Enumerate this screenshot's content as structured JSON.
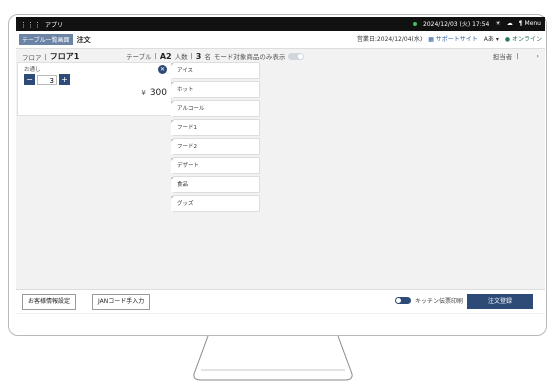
{
  "titlebar": {
    "app_label": "アプリ",
    "datetime": "2024/12/03 (火) 17:54",
    "menu_label": "Menu"
  },
  "header": {
    "back_label": "テーブル一覧画面",
    "title": "注文",
    "business_date": "営業日:2024/12/04(水)",
    "support_label": "サポートサイト",
    "lang_label": "Aあ",
    "online_label": "オンライン"
  },
  "subinfo": {
    "floor_label": "フロア",
    "floor_value": "フロア1",
    "table_label": "テーブル",
    "table_value": "A2",
    "people_label": "人数",
    "people_value": "3",
    "people_unit": "名",
    "mode_label": "モード対象商品のみ表示",
    "staff_label": "担当者"
  },
  "order": {
    "item_name": "お通し",
    "quantity": "3",
    "currency": "¥",
    "price": "300"
  },
  "categories": [
    "アイス",
    "ホット",
    "アルコール",
    "フード1",
    "フード2",
    "デザート",
    "食品",
    "グッズ"
  ],
  "footer": {
    "customer_info_label": "お客様情報設定",
    "jan_label": "JANコード手入力",
    "kitchen_label": "キッチン伝票印刷",
    "submit_label": "注文登録"
  },
  "colors": {
    "accent": "#2e4b78",
    "online": "#2a7a55"
  }
}
